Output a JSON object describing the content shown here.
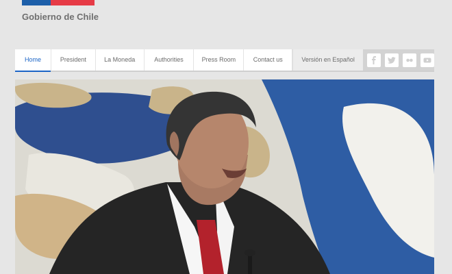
{
  "brand": {
    "name": "Gobierno de Chile"
  },
  "nav": {
    "items": [
      {
        "label": "Home",
        "active": true
      },
      {
        "label": "President",
        "active": false
      },
      {
        "label": "La Moneda",
        "active": false
      },
      {
        "label": "Authorities",
        "active": false
      },
      {
        "label": "Press Room",
        "active": false
      },
      {
        "label": "Contact us",
        "active": false
      }
    ],
    "spanish_label": "Versión en Español"
  },
  "social": {
    "icons": [
      "facebook-icon",
      "twitter-icon",
      "flickr-icon",
      "youtube-icon"
    ]
  },
  "colors": {
    "accent": "#1a64c6",
    "flag_blue": "#1d5fa9",
    "flag_red": "#e63b46",
    "background": "#e6e6e6"
  },
  "hero": {
    "image": "photo of a man speaking at a podium"
  }
}
